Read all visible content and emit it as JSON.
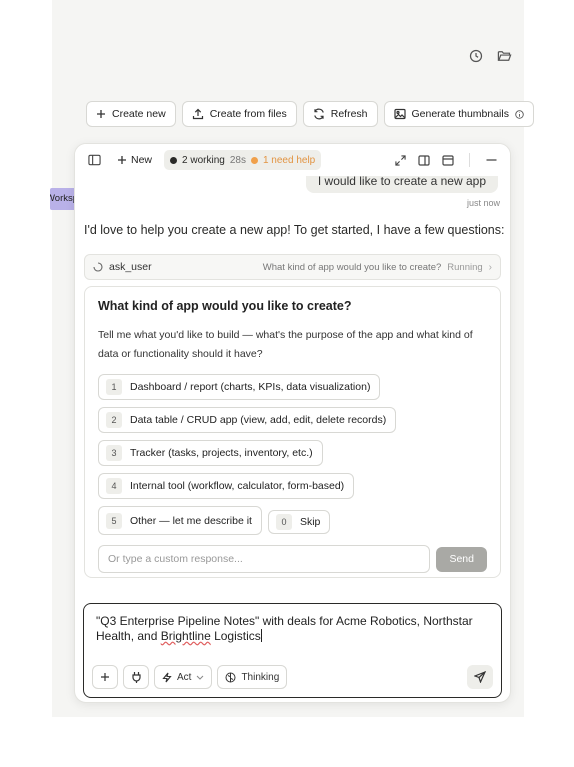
{
  "toolbar": {
    "create_new": "Create new",
    "create_from_files": "Create from files",
    "refresh": "Refresh",
    "generate_thumbnails": "Generate thumbnails"
  },
  "sidetab": {
    "label": "Worksp"
  },
  "panel": {
    "new_label": "New",
    "working": "2 working",
    "elapsed": "28s",
    "need_help": "1 need help"
  },
  "chat": {
    "user_message": "I would like to create a new app",
    "timestamp": "just now",
    "assistant_message": "I'd love to help you create a new app! To get started, I have a few questions:",
    "tool": {
      "name": "ask_user",
      "question": "What kind of app would you like to create?",
      "status": "Running"
    }
  },
  "question_card": {
    "title": "What kind of app would you like to create?",
    "description": "Tell me what you'd like to build — what's the purpose of the app and what kind of data or functionality should it have?",
    "options": [
      {
        "num": "1",
        "label": "Dashboard / report (charts, KPIs, data visualization)"
      },
      {
        "num": "2",
        "label": "Data table / CRUD app (view, add, edit, delete records)"
      },
      {
        "num": "3",
        "label": "Tracker (tasks, projects, inventory, etc.)"
      },
      {
        "num": "4",
        "label": "Internal tool (workflow, calculator, form-based)"
      },
      {
        "num": "5",
        "label": "Other — let me describe it"
      }
    ],
    "skip_num": "0",
    "skip_label": "Skip",
    "custom_placeholder": "Or type a custom response...",
    "send_label": "Send"
  },
  "composer": {
    "text_part1": "\"Q3 Enterprise Pipeline Notes\" with deals for Acme Robotics, Northstar Health, and ",
    "text_misspelled": "Brightline",
    "text_part2": " Logistics",
    "act_label": "Act",
    "thinking_label": "Thinking"
  },
  "colors": {
    "accent_orange": "#f0a04b",
    "sidetab_purple": "#b9b1e8",
    "send_disabled": "#a9a9a5"
  }
}
